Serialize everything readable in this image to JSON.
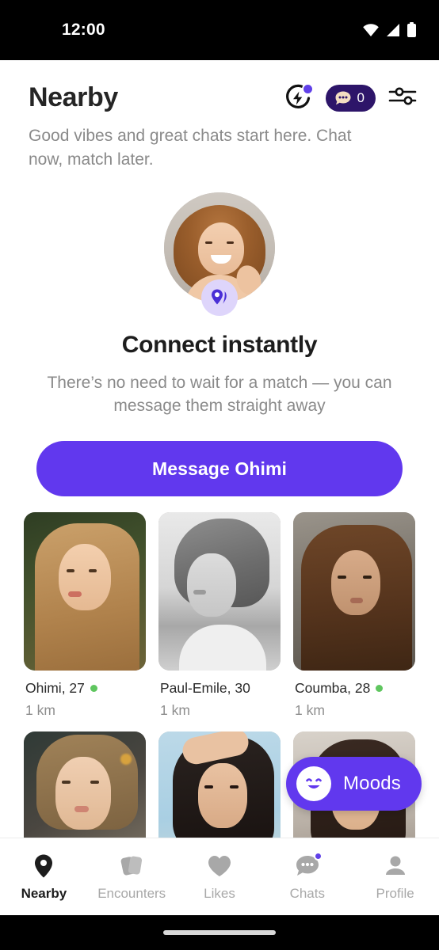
{
  "status_bar": {
    "time": "12:00",
    "icons": [
      "wifi-icon",
      "cellular-signal-icon",
      "battery-icon"
    ]
  },
  "header": {
    "title": "Nearby",
    "bolt_icon": "lightning-bolt-icon",
    "bolt_has_badge": true,
    "chat_icon": "chat-bubble-icon",
    "chat_count": "0",
    "filter_icon": "filter-sliders-icon",
    "accent_purple": "#6138ee",
    "chat_pill_bg": "#2d1569"
  },
  "intro": {
    "text": "Good vibes and great chats start here. Chat now, match later."
  },
  "hero": {
    "avatar_name": "profile-avatar",
    "badge_icon": "location-pin-icon",
    "title": "Connect instantly",
    "subtitle": "There’s no need to wait for a match — you can message them straight away",
    "cta_label": "Message Ohimi"
  },
  "grid": {
    "cards": [
      {
        "name": "Ohimi, 27",
        "distance": "1 km",
        "online": true,
        "photo": "p1"
      },
      {
        "name": "Paul-Emile, 30",
        "distance": "1 km",
        "online": false,
        "photo": "p2"
      },
      {
        "name": "Coumba, 28",
        "distance": "1 km",
        "online": true,
        "photo": "p3"
      },
      {
        "name": "",
        "distance": "",
        "online": false,
        "photo": "p4"
      },
      {
        "name": "",
        "distance": "",
        "online": false,
        "photo": "p5"
      },
      {
        "name": "",
        "distance": "",
        "online": false,
        "photo": "p6"
      }
    ]
  },
  "moods": {
    "label": "Moods",
    "icon": "smiley-face-icon"
  },
  "bottom_nav": {
    "items": [
      {
        "label": "Nearby",
        "icon": "location-pin-icon",
        "active": true,
        "badge": false
      },
      {
        "label": "Encounters",
        "icon": "cards-stack-icon",
        "active": false,
        "badge": false
      },
      {
        "label": "Likes",
        "icon": "heart-icon",
        "active": false,
        "badge": false
      },
      {
        "label": "Chats",
        "icon": "chat-bubble-icon",
        "active": false,
        "badge": true
      },
      {
        "label": "Profile",
        "icon": "person-icon",
        "active": false,
        "badge": false
      }
    ]
  }
}
